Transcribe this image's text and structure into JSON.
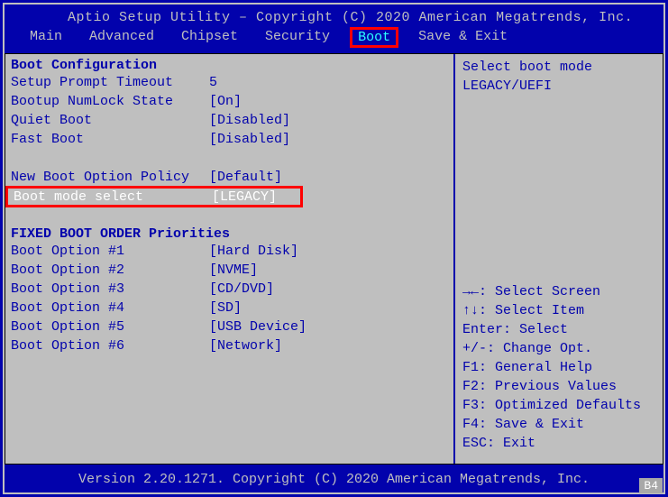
{
  "title": "Aptio Setup Utility – Copyright (C) 2020 American Megatrends, Inc.",
  "menu": {
    "items": [
      "Main",
      "Advanced",
      "Chipset",
      "Security",
      "Boot",
      "Save & Exit"
    ],
    "active": "Boot"
  },
  "left": {
    "section1_title": "Boot Configuration",
    "rows": [
      {
        "label": "Setup Prompt Timeout",
        "value": "5"
      },
      {
        "label": "Bootup NumLock State",
        "value": "[On]"
      },
      {
        "label": "Quiet Boot",
        "value": "[Disabled]"
      },
      {
        "label": "Fast Boot",
        "value": "[Disabled]"
      }
    ],
    "new_policy": {
      "label": "New Boot Option Policy",
      "value": "[Default]"
    },
    "selected": {
      "label": "Boot mode select",
      "value": "[LEGACY]"
    },
    "section2_title": "FIXED BOOT ORDER Priorities",
    "boot_options": [
      {
        "label": "Boot Option #1",
        "value": "[Hard Disk]"
      },
      {
        "label": "Boot Option #2",
        "value": "[NVME]"
      },
      {
        "label": "Boot Option #3",
        "value": "[CD/DVD]"
      },
      {
        "label": "Boot Option #4",
        "value": "[SD]"
      },
      {
        "label": "Boot Option #5",
        "value": "[USB Device]"
      },
      {
        "label": "Boot Option #6",
        "value": "[Network]"
      }
    ]
  },
  "right": {
    "help_top": [
      "Select boot mode",
      "LEGACY/UEFI"
    ],
    "help_bottom": [
      "→←: Select Screen",
      "↑↓: Select Item",
      "Enter: Select",
      "+/-: Change Opt.",
      "F1: General Help",
      "F2: Previous Values",
      "F3: Optimized Defaults",
      "F4: Save & Exit",
      "ESC: Exit"
    ]
  },
  "footer": "Version 2.20.1271. Copyright (C) 2020 American Megatrends, Inc.",
  "corner": "B4"
}
